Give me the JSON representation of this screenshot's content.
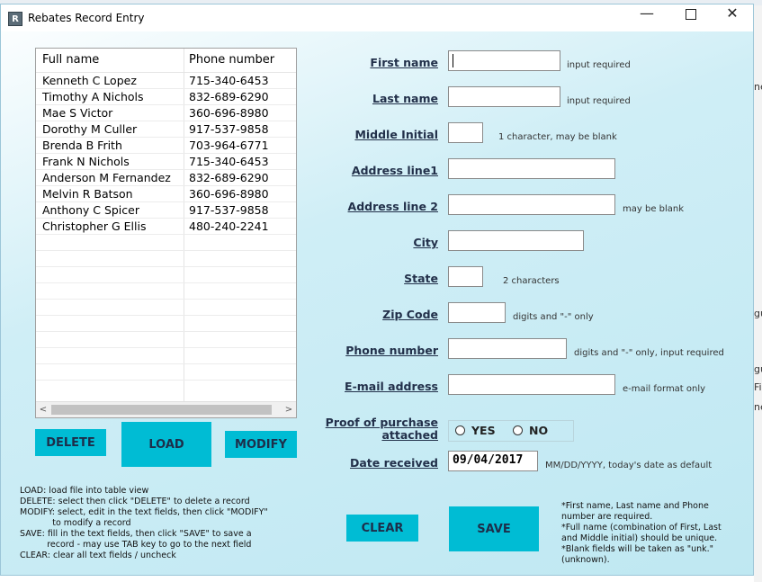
{
  "window": {
    "title": "Rebates Record Entry",
    "icon_letter": "R",
    "min_glyph": "—",
    "close_glyph": "✕"
  },
  "background_fragments": {
    "a": "ne",
    "b": "gu",
    "c": "gu",
    "d": "Fi",
    "e": "ne"
  },
  "table": {
    "headers": [
      "Full name",
      "Phone number"
    ],
    "rows": [
      [
        "Kenneth C Lopez",
        "715-340-6453"
      ],
      [
        "Timothy A Nichols",
        "832-689-6290"
      ],
      [
        "Mae S Victor",
        "360-696-8980"
      ],
      [
        "Dorothy M Culler",
        "917-537-9858"
      ],
      [
        "Brenda B Frith",
        "703-964-6771"
      ],
      [
        "Frank N Nichols",
        "715-340-6453"
      ],
      [
        "Anderson M Fernandez",
        "832-689-6290"
      ],
      [
        "Melvin R Batson",
        "360-696-8980"
      ],
      [
        "Anthony C Spicer",
        "917-537-9858"
      ],
      [
        "Christopher G Ellis",
        "480-240-2241"
      ],
      [
        "",
        ""
      ],
      [
        "",
        ""
      ],
      [
        "",
        ""
      ],
      [
        "",
        ""
      ],
      [
        "",
        ""
      ],
      [
        "",
        ""
      ],
      [
        "",
        ""
      ],
      [
        "",
        ""
      ],
      [
        "",
        ""
      ]
    ],
    "scroll_left": "<",
    "scroll_right": ">"
  },
  "buttons": {
    "delete": "DELETE",
    "load": "LOAD",
    "modify": "MODIFY",
    "clear": "CLEAR",
    "save": "SAVE"
  },
  "form": {
    "first_name": {
      "label": "First name",
      "value": "",
      "hint": "input required"
    },
    "last_name": {
      "label": "Last name",
      "value": "",
      "hint": "input required"
    },
    "middle_initial": {
      "label": "Middle Initial",
      "value": "",
      "hint": "1 character, may be blank"
    },
    "address1": {
      "label": "Address line1",
      "value": "",
      "hint": ""
    },
    "address2": {
      "label": "Address line 2",
      "value": "",
      "hint": "may be blank"
    },
    "city": {
      "label": "City",
      "value": "",
      "hint": ""
    },
    "state": {
      "label": "State",
      "value": "",
      "hint": "2 characters"
    },
    "zip": {
      "label": "Zip Code",
      "value": "",
      "hint": "digits and \"-\" only"
    },
    "phone": {
      "label": "Phone number",
      "value": "",
      "hint": "digits and \"-\" only, input required"
    },
    "email": {
      "label": "E-mail address",
      "value": "",
      "hint": "e-mail format only"
    },
    "proof": {
      "label_line1": "Proof of purchase",
      "label_line2": "attached",
      "yes": "YES",
      "no": "NO"
    },
    "date": {
      "label": "Date received",
      "value": "09/04/2017",
      "hint": "MM/DD/YYYY, today's date as default"
    }
  },
  "help_text": "LOAD: load file into table view\nDELETE: select then click \"DELETE\" to delete a record\nMODIFY: select, edit in the text fields, then click \"MODIFY\"\n            to modify a record\nSAVE: fill in the text fields, then click \"SAVE\" to save a\n          record - may use TAB key to go to the next field\nCLEAR: clear all text fields / uncheck",
  "notes_text": "*First name, Last name and Phone\nnumber are required.\n*Full name (combination of First, Last\nand Middle initial) should be unique.\n*Blank fields will be taken as \"unk.\"\n(unknown).",
  "colors": {
    "button_bg": "#00bcd4",
    "label_text": "#22304a"
  }
}
